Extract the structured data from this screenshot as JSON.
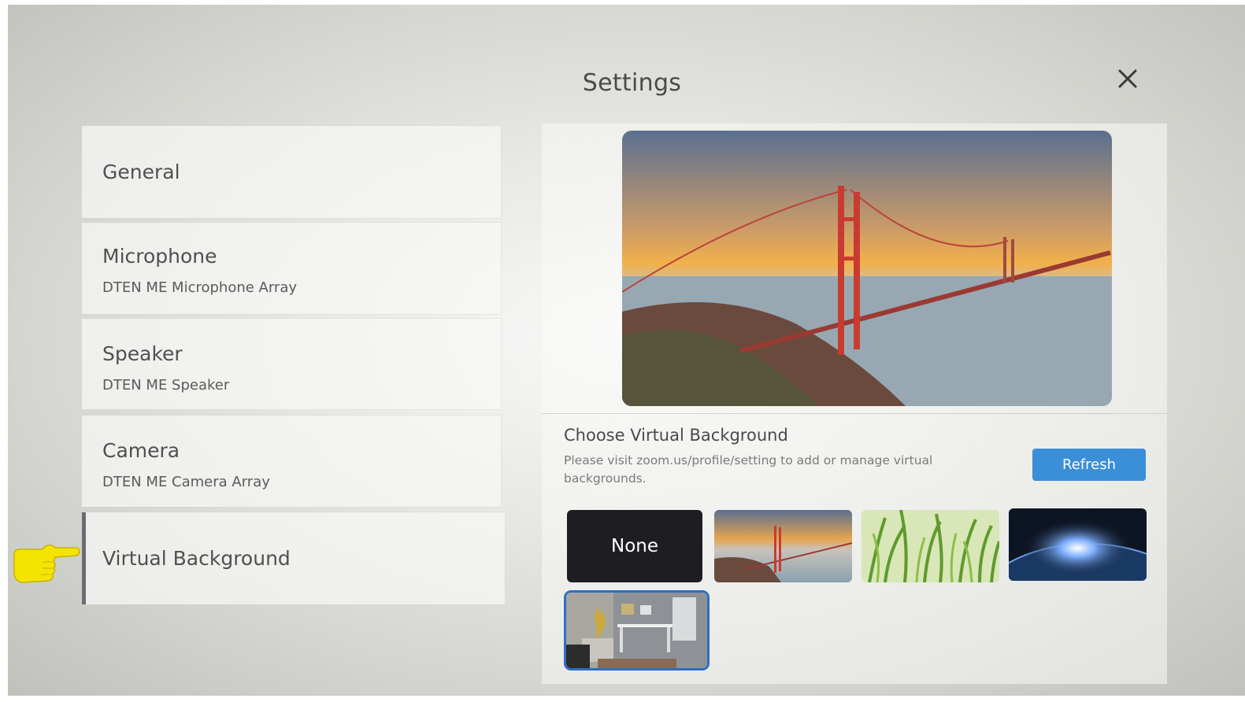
{
  "dialog": {
    "title": "Settings"
  },
  "menu": {
    "items": [
      {
        "label": "General",
        "sub": ""
      },
      {
        "label": "Microphone",
        "sub": "DTEN ME Microphone Array"
      },
      {
        "label": "Speaker",
        "sub": "DTEN ME Speaker"
      },
      {
        "label": "Camera",
        "sub": "DTEN ME Camera Array"
      },
      {
        "label": "Virtual Background",
        "sub": ""
      }
    ],
    "active": "Virtual Background"
  },
  "virtual_background": {
    "title": "Choose Virtual Background",
    "description": "Please visit zoom.us/profile/setting to add or manage virtual backgrounds.",
    "refresh_label": "Refresh",
    "none_label": "None",
    "thumbnails": [
      "None",
      "golden-gate-bridge",
      "grass",
      "earth-from-space",
      "living-room"
    ],
    "selected": "living-room"
  },
  "colors": {
    "accent": "#3b8ed8",
    "selected_border": "#2d6fc4",
    "none_tile": "#1d1d22",
    "pointer": "#f5e400"
  }
}
